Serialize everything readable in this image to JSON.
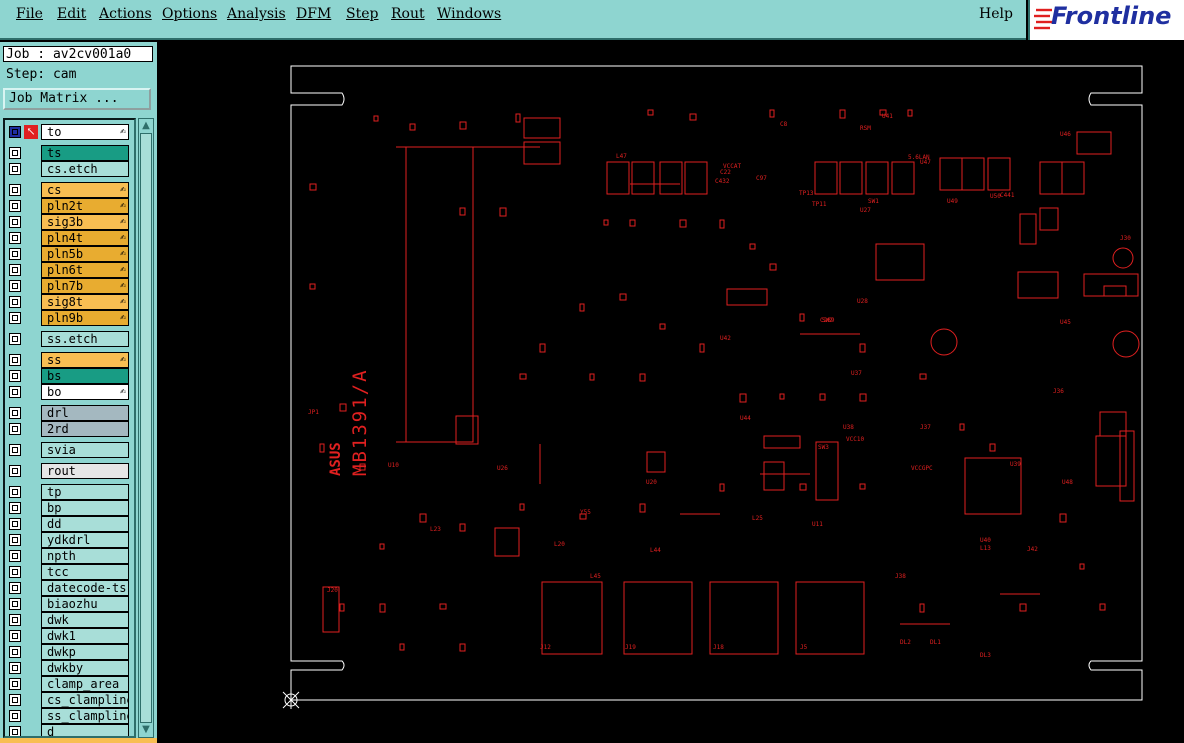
{
  "menubar": {
    "items": [
      {
        "label": "File"
      },
      {
        "label": "Edit"
      },
      {
        "label": "Actions"
      },
      {
        "label": "Options"
      },
      {
        "label": "Analysis"
      },
      {
        "label": "DFM"
      },
      {
        "label": "Step"
      },
      {
        "label": "Rout"
      },
      {
        "label": "Windows"
      }
    ],
    "help_label": "Help"
  },
  "brand": {
    "name": "Frontline"
  },
  "job": {
    "label": "Job : av2cv001a0",
    "step": "Step: cam",
    "matrix_button": "Job Matrix ..."
  },
  "layers": [
    {
      "name": "to",
      "color": "#ffffff",
      "icon": "edit-icon"
    },
    {
      "name": "ts",
      "color": "#189c84"
    },
    {
      "name": "cs.etch",
      "color": "#a8ded8"
    },
    {
      "name": "cs",
      "color": "#f8be52",
      "icon": "edit-icon"
    },
    {
      "name": "pln2t",
      "color": "#e8ac30",
      "icon": "edit-icon"
    },
    {
      "name": "sig3b",
      "color": "#f8be52",
      "icon": "edit-icon"
    },
    {
      "name": "pln4t",
      "color": "#e8ac30",
      "icon": "edit-icon"
    },
    {
      "name": "pln5b",
      "color": "#e8ac30",
      "icon": "edit-icon"
    },
    {
      "name": "pln6t",
      "color": "#e8ac30",
      "icon": "edit-icon"
    },
    {
      "name": "pln7b",
      "color": "#e8ac30",
      "icon": "edit-icon"
    },
    {
      "name": "sig8t",
      "color": "#f8be52",
      "icon": "edit-icon"
    },
    {
      "name": "pln9b",
      "color": "#e8ac30",
      "icon": "edit-icon"
    },
    {
      "name": "ss.etch",
      "color": "#a8ded8"
    },
    {
      "name": "ss",
      "color": "#f8be52",
      "icon": "edit-icon"
    },
    {
      "name": "bs",
      "color": "#189c84"
    },
    {
      "name": "bo",
      "color": "#ffffff",
      "icon": "edit-icon"
    },
    {
      "name": "drl",
      "color": "#a4b8c0"
    },
    {
      "name": "2rd",
      "color": "#a4b8c0"
    },
    {
      "name": "svia",
      "color": "#a8ded8"
    },
    {
      "name": "rout",
      "color": "#e6e6e6"
    },
    {
      "name": "tp",
      "color": "#a8ded8"
    },
    {
      "name": "bp",
      "color": "#a8ded8"
    },
    {
      "name": "dd",
      "color": "#a8ded8"
    },
    {
      "name": "ydkdrl",
      "color": "#a8ded8"
    },
    {
      "name": "npth",
      "color": "#a8ded8"
    },
    {
      "name": "tcc",
      "color": "#a8ded8"
    },
    {
      "name": "datecode-ts",
      "color": "#a8ded8"
    },
    {
      "name": "biaozhu",
      "color": "#a8ded8"
    },
    {
      "name": "dwk",
      "color": "#a8ded8"
    },
    {
      "name": "dwk1",
      "color": "#a8ded8"
    },
    {
      "name": "dwkp",
      "color": "#a8ded8"
    },
    {
      "name": "dwkby",
      "color": "#a8ded8"
    },
    {
      "name": "clamp_area",
      "color": "#a8ded8"
    },
    {
      "name": "cs_clampline",
      "color": "#a8ded8"
    },
    {
      "name": "ss_clampline",
      "color": "#a8ded8"
    },
    {
      "name": "d",
      "color": "#a8ded8"
    }
  ],
  "board": {
    "part_number": "MB1391/A",
    "logo": "ASUS",
    "silk_color": "#e02020",
    "outline_color": "#ffffff",
    "labels": [
      "J20",
      "J19",
      "J18",
      "J5",
      "J12",
      "J42",
      "J38",
      "J37",
      "J36",
      "J30",
      "JP1",
      "DL1",
      "DL2",
      "DL3",
      "U11",
      "U10",
      "U20",
      "U26",
      "U27",
      "U28",
      "U37",
      "U38",
      "U39",
      "U40",
      "U41",
      "U42",
      "U44",
      "U45",
      "U46",
      "U47",
      "U48",
      "U49",
      "U50",
      "C441",
      "C432",
      "C289",
      "VCCAT",
      "VCC10",
      "VCCGPC",
      "TP13",
      "TP11",
      "SW1",
      "SW2",
      "SW3",
      "Y55",
      "L20",
      "L25",
      "L23",
      "L13",
      "L44",
      "L45",
      "L47",
      "C22",
      "C97",
      "C8",
      "RSM",
      "5.6LAN"
    ]
  },
  "colors": {
    "menubar": "#8ed5d0",
    "accent": "#2e6e6a",
    "canvas": "#000000"
  }
}
